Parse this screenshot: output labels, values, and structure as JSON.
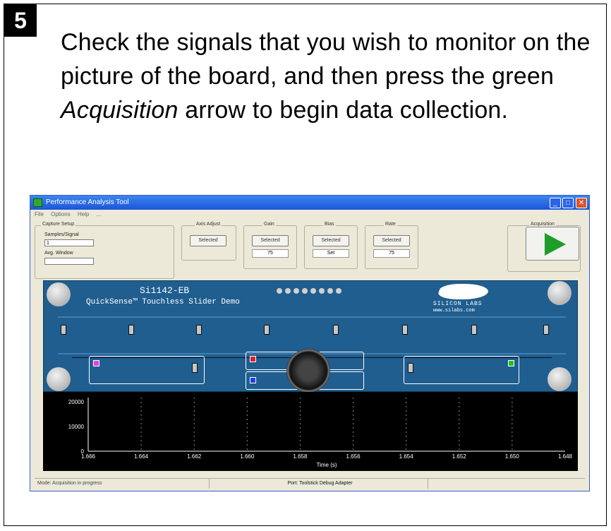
{
  "step": {
    "number": "5",
    "text_before": "Check the signals that you wish to monitor on the picture of the board, and then press the green ",
    "text_em": "Acquisition",
    "text_after": " arrow to begin data collection."
  },
  "window": {
    "title": "Performance Analysis Tool",
    "min": "_",
    "max": "□",
    "close": "✕",
    "menu": [
      "File",
      "Options",
      "Help",
      "..."
    ]
  },
  "toolbar": {
    "group_main": "Capture Setup",
    "sample_label": "Samples/Signal",
    "sample_value": "1",
    "avg_label": "Avg. Window",
    "groups": [
      {
        "label": "Axis Adjust",
        "button": "Selected",
        "value": ""
      },
      {
        "label": "Gain",
        "button": "Selected",
        "value": "75"
      },
      {
        "label": "Bias",
        "button": "Selected",
        "value": "Set"
      },
      {
        "label": "Rate",
        "button": "Selected",
        "value": "75"
      }
    ],
    "acquisition_label": "Acquisition"
  },
  "board": {
    "title": "Si1142-EB",
    "subtitle": "QuickSense™ Touchless Slider Demo",
    "logo_text": "SILICON LABS",
    "logo_url": "www.silabs.com"
  },
  "chart_data": {
    "type": "line",
    "xlabel": "Time (s)",
    "ylabel": "",
    "y_ticks": [
      "20000",
      "10000",
      "0"
    ],
    "x_ticks": [
      "1.666",
      "1.664",
      "1.662",
      "1.660",
      "1.658",
      "1.656",
      "1.654",
      "1.652",
      "1.650",
      "1.648"
    ],
    "series": []
  },
  "status": {
    "left": "Mode: Acquisition in progress",
    "middle": "Port: Toolstick Debug Adapter",
    "right": ""
  },
  "colors": {
    "accent_green": "#1f9d2a",
    "board_blue": "#1f5e8f",
    "titlebar_blue": "#1c55d8"
  }
}
